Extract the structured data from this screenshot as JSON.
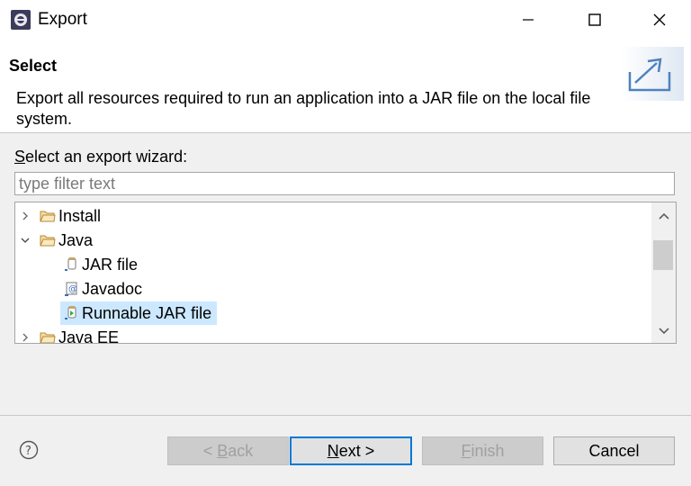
{
  "window": {
    "title": "Export",
    "icon": "eclipse-icon",
    "controls": [
      "minimize-icon",
      "maximize-icon",
      "close-icon"
    ]
  },
  "header": {
    "title": "Select",
    "description": "Export all resources required to run an application into a JAR file on the local file system.",
    "banner_icon": "export-banner-icon"
  },
  "wizard": {
    "prompt_mnemonic": "S",
    "prompt_rest": "elect an export wizard:",
    "filter_placeholder": "type filter text",
    "filter_value": "",
    "tree": [
      {
        "label": "Install",
        "icon": "folder-icon",
        "expanded": false,
        "level": 0
      },
      {
        "label": "Java",
        "icon": "folder-icon",
        "expanded": true,
        "level": 0
      },
      {
        "label": "JAR file",
        "icon": "jar-file-icon",
        "level": 1
      },
      {
        "label": "Javadoc",
        "icon": "javadoc-icon",
        "level": 1
      },
      {
        "label": "Runnable JAR file",
        "icon": "runnable-jar-icon",
        "level": 1,
        "selected": true
      },
      {
        "label": "Java EE",
        "icon": "folder-icon",
        "expanded": false,
        "level": 0
      }
    ]
  },
  "buttons": {
    "back_prefix": "< ",
    "back_mnemonic": "B",
    "back_rest": "ack",
    "next_mnemonic": "N",
    "next_rest": "ext >",
    "finish_mnemonic": "F",
    "finish_rest": "inish",
    "cancel": "Cancel"
  },
  "colors": {
    "selection": "#cce8ff",
    "default_button_border": "#0078d7"
  }
}
